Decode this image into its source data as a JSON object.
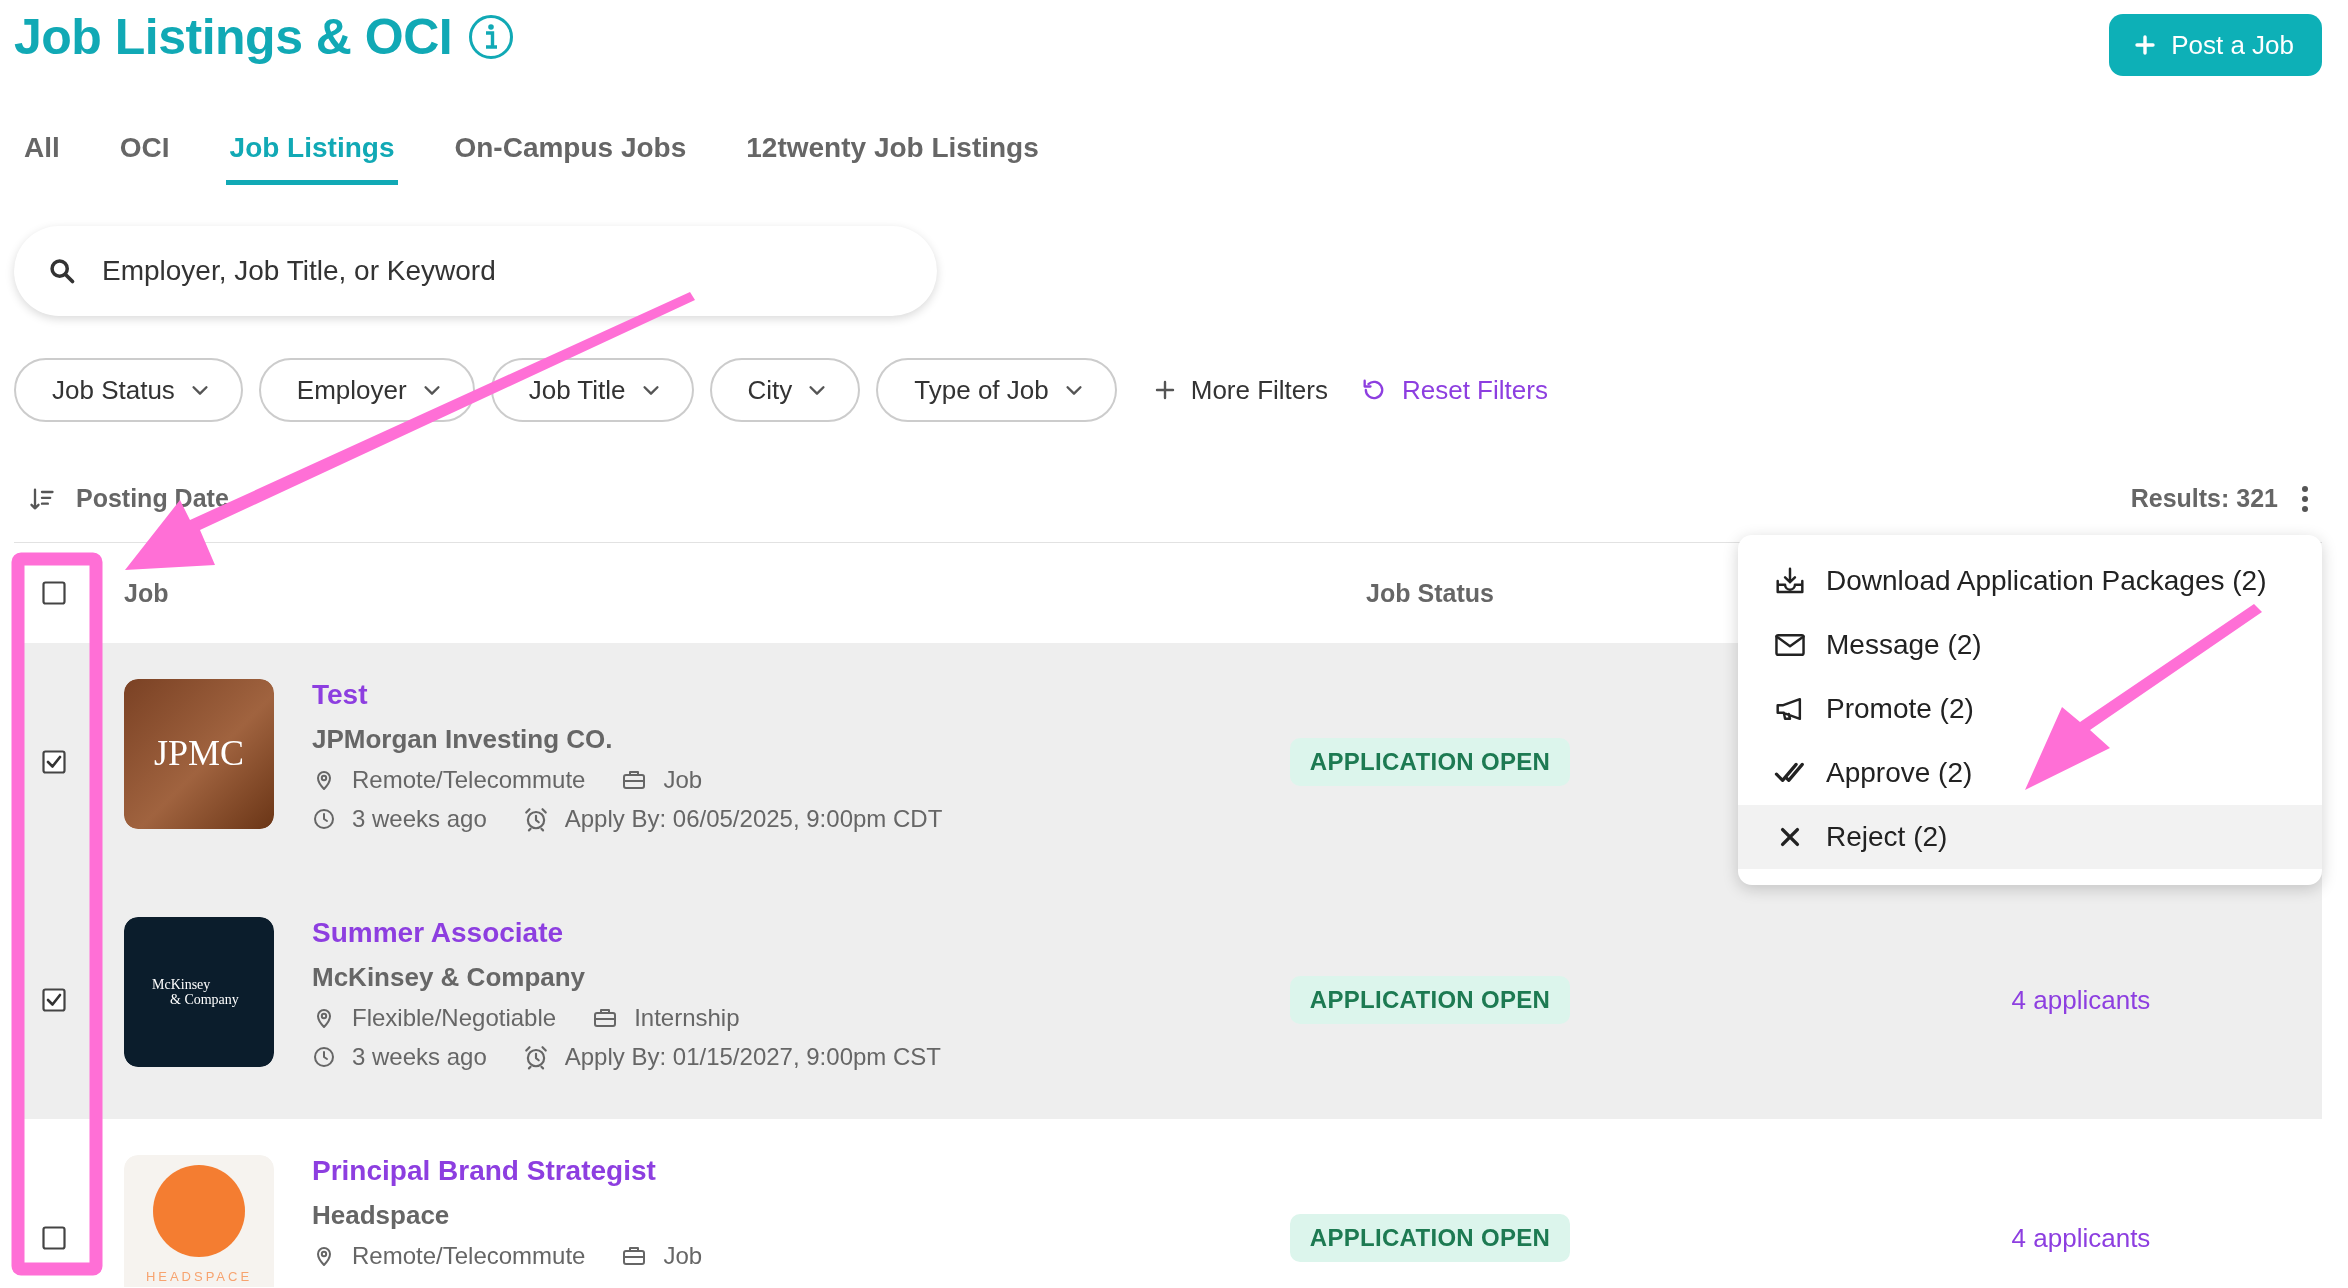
{
  "page": {
    "title": "Job Listings & OCI"
  },
  "post_button": {
    "label": "Post a Job"
  },
  "tabs": [
    {
      "label": "All",
      "selected": false
    },
    {
      "label": "OCI",
      "selected": false
    },
    {
      "label": "Job Listings",
      "selected": true
    },
    {
      "label": "On-Campus Jobs",
      "selected": false
    },
    {
      "label": "12twenty Job Listings",
      "selected": false
    }
  ],
  "search": {
    "placeholder": "Employer, Job Title, or Keyword"
  },
  "filters": [
    "Job Status",
    "Employer",
    "Job Title",
    "City",
    "Type of Job"
  ],
  "more_filters": "More Filters",
  "reset_filters": "Reset Filters",
  "sort": {
    "label": "Posting Date"
  },
  "results": "Results: 321",
  "table": {
    "select_all": {
      "checked": false
    },
    "columns": [
      "Job",
      "Job Status"
    ],
    "rows": [
      {
        "checked": true,
        "logo": {
          "kind": "gradient",
          "lines": [
            "JPMC"
          ]
        },
        "title": "Test",
        "employer": "JPMorgan Investing CO.",
        "location": "Remote/Telecommute",
        "job_type": "Job",
        "posted": "3 weeks ago",
        "apply_by": "Apply By: 06/05/2025, 9:00pm CDT",
        "status": {
          "label": "APPLICATION OPEN",
          "kind": "open"
        }
      },
      {
        "checked": true,
        "logo": {
          "kind": "dark",
          "lines": [
            "McKinsey",
            "& Company"
          ]
        },
        "title": "Summer Associate",
        "employer": "McKinsey & Company",
        "location": "Flexible/Negotiable",
        "job_type": "Internship",
        "posted": "3 weeks ago",
        "apply_by": "Apply By: 01/15/2027, 9:00pm CST",
        "status": {
          "label": "APPLICATION OPEN",
          "kind": "open"
        },
        "applicants": "4 applicants"
      },
      {
        "checked": false,
        "logo": {
          "kind": "circle",
          "lines": [
            "HEADSPACE"
          ]
        },
        "title": "Principal Brand Strategist",
        "employer": "Headspace",
        "location": "Remote/Telecommute",
        "job_type": "Job",
        "status": {
          "label": "APPLICATION OPEN",
          "kind": "open"
        },
        "applicants": "4 applicants"
      }
    ]
  },
  "bulk_menu": {
    "items": [
      {
        "label": "Download Application Packages (2)",
        "highlighted": false
      },
      {
        "label": "Message (2)",
        "highlighted": false
      },
      {
        "label": "Promote (2)",
        "highlighted": false
      },
      {
        "label": "Approve (2)",
        "highlighted": false
      },
      {
        "label": "Reject (2)",
        "highlighted": true
      }
    ]
  },
  "annotations": [
    {
      "kind": "arrow"
    },
    {
      "kind": "arrow"
    },
    {
      "kind": "frame"
    }
  ]
}
